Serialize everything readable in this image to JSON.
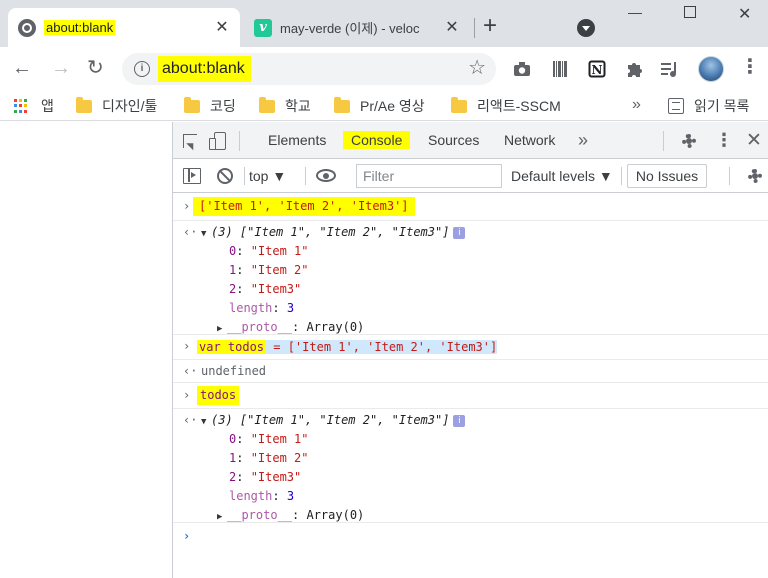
{
  "tabs": [
    {
      "title": "about:blank",
      "icon": "globe-icon",
      "active": true
    },
    {
      "title": "may-verde (이제) - veloc",
      "icon": "velog-icon",
      "active": false
    }
  ],
  "toolbar": {
    "url": "about:blank"
  },
  "bookmarks": {
    "apps_label": "앱",
    "folders": [
      "디자인/툴",
      "코딩",
      "학교",
      "Pr/Ae 영상",
      "리액트-SSCM"
    ],
    "more": "»",
    "reading_list": "읽기 목록"
  },
  "devtools": {
    "tabs": [
      "Elements",
      "Console",
      "Sources",
      "Network"
    ],
    "active_tab": "Console",
    "more": "»",
    "context": "top ▼",
    "filter_placeholder": "Filter",
    "levels": "Default levels ▼",
    "issues": "No Issues"
  },
  "console": {
    "in1": "['Item 1', 'Item 2', 'Item3']",
    "out1_summary": {
      "count": "(3)",
      "items": "[\"Item 1\", \"Item 2\", \"Item3\"]"
    },
    "out1_props": [
      {
        "key": "0",
        "value": "\"Item 1\""
      },
      {
        "key": "1",
        "value": "\"Item 2\""
      },
      {
        "key": "2",
        "value": "\"Item3\""
      }
    ],
    "out1_length_key": "length",
    "out1_length_value": "3",
    "proto_key": "__proto__",
    "proto_value": "Array(0)",
    "in2_kw": "var todos",
    "in2_rest": " = ['Item 1', 'Item 2', 'Item3']",
    "out2": "undefined",
    "in3": "todos",
    "out3_summary": {
      "count": "(3)",
      "items": "[\"Item 1\", \"Item 2\", \"Item3\"]"
    },
    "out3_props": [
      {
        "key": "0",
        "value": "\"Item 1\""
      },
      {
        "key": "1",
        "value": "\"Item 2\""
      },
      {
        "key": "2",
        "value": "\"Item3\""
      }
    ],
    "out3_length_key": "length",
    "out3_length_value": "3"
  },
  "colors": {
    "highlight": "#ffff00",
    "selection": "#cfe8fc",
    "string": "#c80000",
    "property_key": "#881280",
    "number": "#1c00cf"
  }
}
